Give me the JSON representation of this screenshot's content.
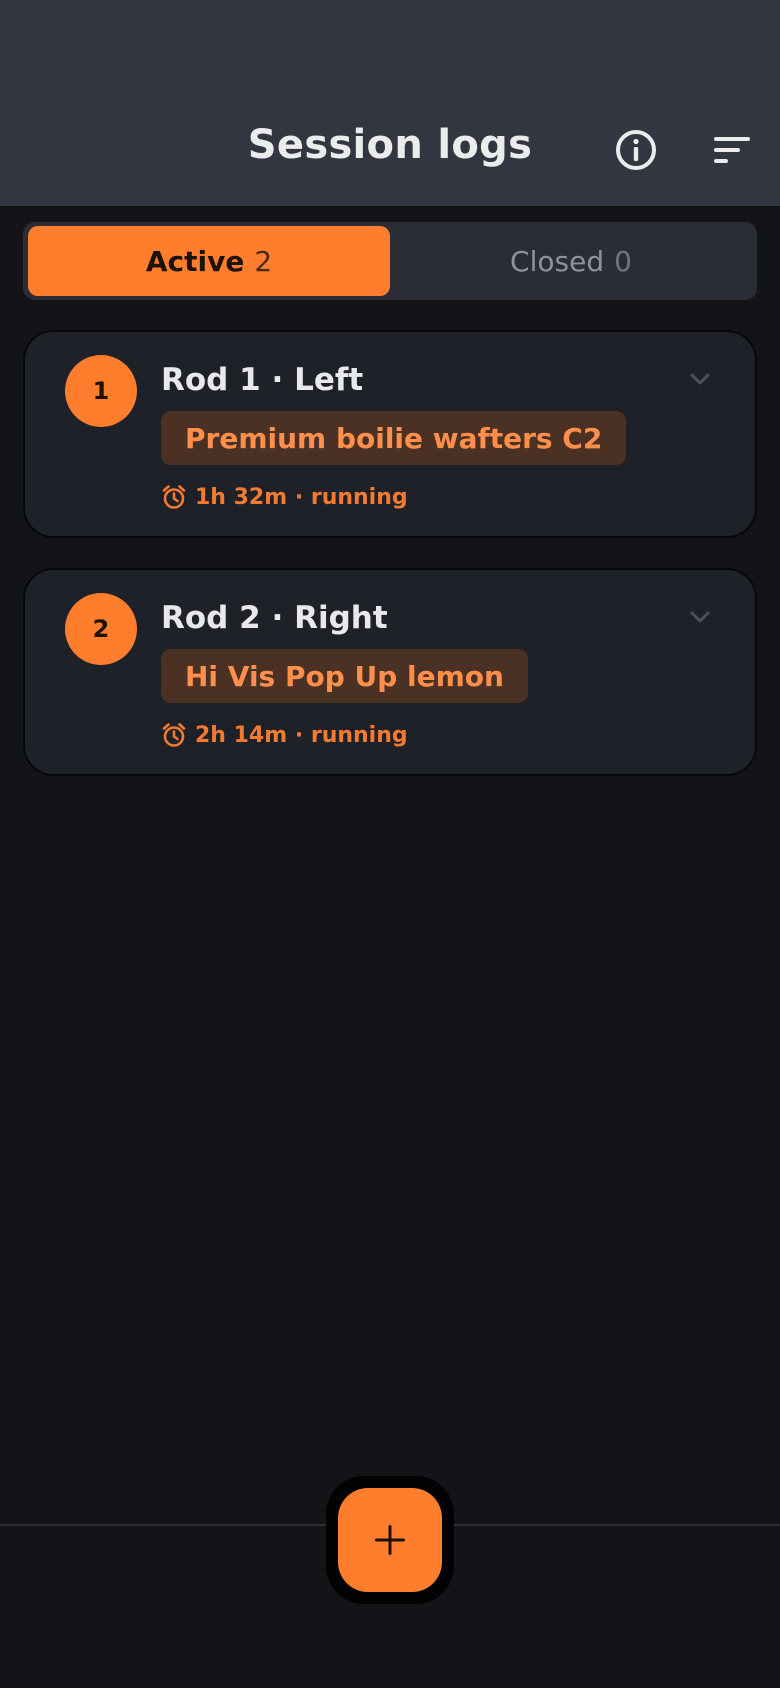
{
  "header": {
    "title": "Session logs",
    "info_icon": "info-circle-icon",
    "sort_icon": "sort-lines-icon"
  },
  "tabs": [
    {
      "label": "Active",
      "count": "2",
      "selected": true
    },
    {
      "label": "Closed",
      "count": "0",
      "selected": false
    }
  ],
  "rods": [
    {
      "number": "1",
      "title": "Rod 1 · Left",
      "bait": "Premium boilie wafters C2",
      "timer": "1h 32m · running"
    },
    {
      "number": "2",
      "title": "Rod 2 · Right",
      "bait": "Hi Vis Pop Up lemon",
      "timer": "2h 14m · running"
    }
  ],
  "fab": {
    "icon": "plus-icon"
  },
  "colors": {
    "accent": "#FF7E2E",
    "header_bg": "#323640",
    "page_bg": "#131418",
    "card_bg": "#1F2128",
    "bait_bg": "#4A3124"
  }
}
